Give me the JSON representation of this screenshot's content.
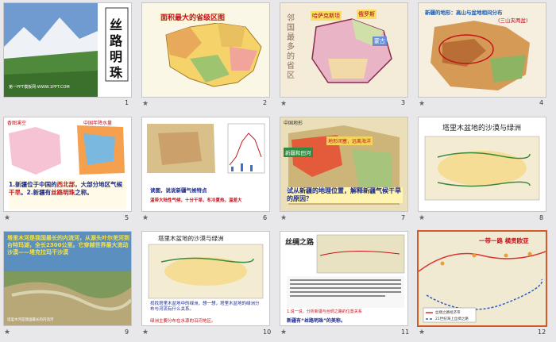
{
  "slides": [
    {
      "n": "1",
      "title": "丝路明珠",
      "caption": "第一PPT模板网-WWW.1PPT.COM"
    },
    {
      "n": "2",
      "title": "面积最大的省级区图"
    },
    {
      "n": "3",
      "labels": [
        "哈萨克斯坦",
        "俄罗斯",
        "蒙古",
        "邻国最多的省区"
      ]
    },
    {
      "n": "4",
      "title": "新疆的地形：高山与盆地相间分布",
      "sub": "(三山夹两盆)"
    },
    {
      "n": "5",
      "labels": [
        "香图溪空",
        "中国年降水量"
      ],
      "q1a": "1.新疆位于中国的",
      "q1b": "西北部",
      "q1c": "，大部分地区气候",
      "q1d": "干旱",
      "q1e": "。2.新疆有",
      "q1f": "丝路明珠",
      "q1g": "之称。"
    },
    {
      "n": "6",
      "q": "读图，说说新疆气候特点",
      "a": "温带大陆性气候，十分干旱，冬冷夏热，温差大"
    },
    {
      "n": "7",
      "labels": [
        "中国地形",
        "新疆和田河",
        "地形闭塞，远离海洋"
      ],
      "q": "试从新疆的地理位置，解释新疆气候干旱的原因？"
    },
    {
      "n": "8",
      "title": "塔里木盆地的沙漠与绿洲"
    },
    {
      "n": "9",
      "text": "塔里木河是我国最长的内流河，从源头叶尔羌河到台特玛湖，全长2300公里。它穿越世界最大流动沙漠——塔克拉玛干沙漠",
      "caption": "塔里木河是我国最长的内流河"
    },
    {
      "n": "10",
      "title": "塔里木盆地的沙漠与绿洲",
      "q": "找找塔里木盆地中的绿洲，想一想，塔里木盆地的绿洲分布与河流有什么关系。",
      "a": "绿洲主要分布在水源的沿河地区。"
    },
    {
      "n": "11",
      "title": "丝绸之路",
      "q1": "1.说一说，分析新疆与丝绸之路的位置关系",
      "q2": "新疆有“丝路明珠”的美称。"
    },
    {
      "n": "12",
      "title": "一带一路 横贯欧亚",
      "legend": [
        "丝绸之路经济带",
        "21世纪海上丝绸之路"
      ]
    }
  ],
  "colors": {
    "selected": "#d05a2a",
    "red": "#c4121a"
  }
}
